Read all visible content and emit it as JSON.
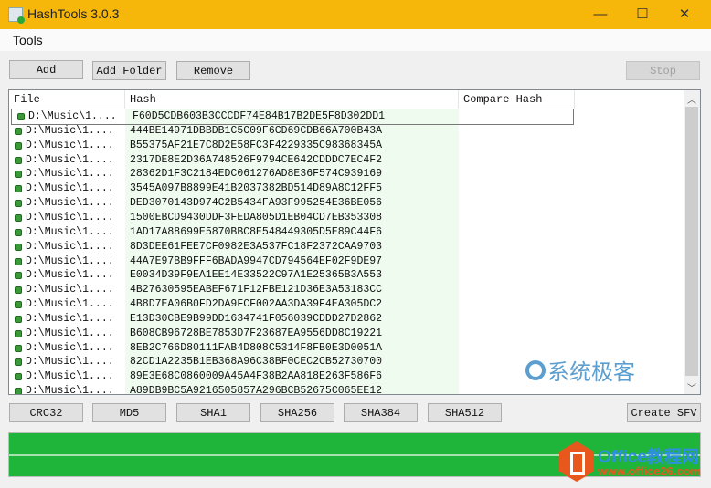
{
  "window": {
    "title": "HashTools 3.0.3",
    "minimize": "—",
    "maximize": "☐",
    "close": "✕"
  },
  "menu": {
    "tools": "Tools"
  },
  "toolbar": {
    "add": "Add",
    "add_folder": "Add Folder",
    "remove": "Remove",
    "stop": "Stop"
  },
  "list": {
    "columns": [
      "File",
      "Hash",
      "Compare Hash"
    ],
    "rows": [
      {
        "file": "D:\\Music\\1....",
        "hash": "F60D5CDB603B3CCCDF74E84B17B2DE5F8D302DD1"
      },
      {
        "file": "D:\\Music\\1....",
        "hash": "444BE14971DBBDB1C5C09F6CD69CDB66A700B43A"
      },
      {
        "file": "D:\\Music\\1....",
        "hash": "B55375AF21E7C8D2E58FC3F4229335C98368345A"
      },
      {
        "file": "D:\\Music\\1....",
        "hash": "2317DE8E2D36A748526F9794CE642CDDDC7EC4F2"
      },
      {
        "file": "D:\\Music\\1....",
        "hash": "28362D1F3C2184EDC061276AD8E36F574C939169"
      },
      {
        "file": "D:\\Music\\1....",
        "hash": "3545A097B8899E41B2037382BD514D89A8C12FF5"
      },
      {
        "file": "D:\\Music\\1....",
        "hash": "DED3070143D974C2B5434FA93F995254E36BE056"
      },
      {
        "file": "D:\\Music\\1....",
        "hash": "1500EBCD9430DDF3FEDA805D1EB04CD7EB353308"
      },
      {
        "file": "D:\\Music\\1....",
        "hash": "1AD17A88699E5870BBC8E548449305D5E89C44F6"
      },
      {
        "file": "D:\\Music\\1....",
        "hash": "8D3DEE61FEE7CF0982E3A537FC18F2372CAA9703"
      },
      {
        "file": "D:\\Music\\1....",
        "hash": "44A7E97BB9FFF6BADA9947CD794564EF02F9DE97"
      },
      {
        "file": "D:\\Music\\1....",
        "hash": "E0034D39F9EA1EE14E33522C97A1E25365B3A553"
      },
      {
        "file": "D:\\Music\\1....",
        "hash": "4B27630595EABEF671F12FBE121D36E3A53183CC"
      },
      {
        "file": "D:\\Music\\1....",
        "hash": "4B8D7EA06B0FD2DA9FCF002AA3DA39F4EA305DC2"
      },
      {
        "file": "D:\\Music\\1....",
        "hash": "E13D30CBE9B99DD1634741F056039CDDD27D2862"
      },
      {
        "file": "D:\\Music\\1....",
        "hash": "B608CB96728BE7853D7F23687EA9556DD8C19221"
      },
      {
        "file": "D:\\Music\\1....",
        "hash": "8EB2C766D80111FAB4D808C5314F8FB0E3D0051A"
      },
      {
        "file": "D:\\Music\\1....",
        "hash": "82CD1A2235B1EB368A96C38BF0CEC2CB52730700"
      },
      {
        "file": "D:\\Music\\1....",
        "hash": "89E3E68C0860009A45A4F38B2AA818E263F586F6"
      },
      {
        "file": "D:\\Music\\1....",
        "hash": "A89DB9BC5A9216505857A296BCB52675C065EE12"
      }
    ]
  },
  "hash_buttons": {
    "crc32": "CRC32",
    "md5": "MD5",
    "sha1": "SHA1",
    "sha256": "SHA256",
    "sha384": "SHA384",
    "sha512": "SHA512",
    "create_sfv": "Create SFV"
  },
  "progress": {
    "percent": 100,
    "color": "#1fb43a"
  },
  "watermarks": {
    "site1": "系统极客",
    "site2_title": "Office教程网",
    "site2_url": "www.office26.com"
  }
}
